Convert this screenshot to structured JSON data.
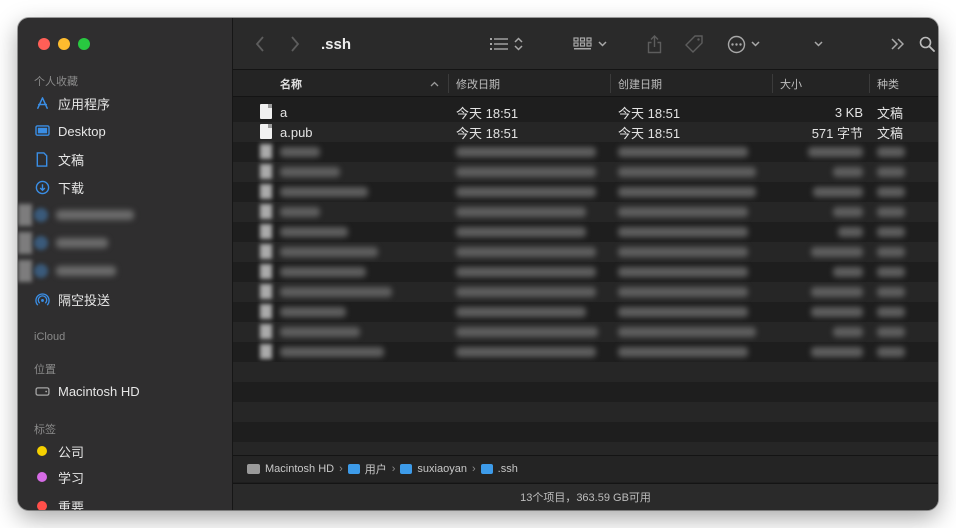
{
  "toolbar": {
    "title": ".ssh"
  },
  "sidebar": {
    "favorites_header": "个人收藏",
    "favorites": [
      {
        "label": "应用程序",
        "icon": "applications-icon"
      },
      {
        "label": "Desktop",
        "icon": "desktop-icon"
      },
      {
        "label": "文稿",
        "icon": "document-icon"
      },
      {
        "label": "下载",
        "icon": "download-icon"
      }
    ],
    "airdrop": {
      "label": "隔空投送",
      "icon": "airdrop-icon"
    },
    "icloud_header": "iCloud",
    "locations_header": "位置",
    "locations": [
      {
        "label": "Macintosh HD",
        "icon": "disk-icon"
      }
    ],
    "tags_header": "标签",
    "tags": [
      {
        "label": "公司",
        "color": "#f5d000"
      },
      {
        "label": "学习",
        "color": "#d66be6"
      },
      {
        "label": "重要",
        "color": "#ff4f4a"
      }
    ]
  },
  "columns": {
    "name": "名称",
    "modified": "修改日期",
    "created": "创建日期",
    "size": "大小",
    "kind": "种类"
  },
  "files": [
    {
      "name": "a",
      "modified": "今天 18:51",
      "created": "今天 18:51",
      "size": "3 KB",
      "kind": "文稿"
    },
    {
      "name": "a.pub",
      "modified": "今天 18:51",
      "created": "今天 18:51",
      "size": "571 字节",
      "kind": "文稿"
    }
  ],
  "pathbar": {
    "items": [
      "Macintosh HD",
      "用户",
      "suxiaoyan",
      ".ssh"
    ],
    "separator": "›"
  },
  "status": {
    "text": "13个项目，363.59 GB可用"
  }
}
